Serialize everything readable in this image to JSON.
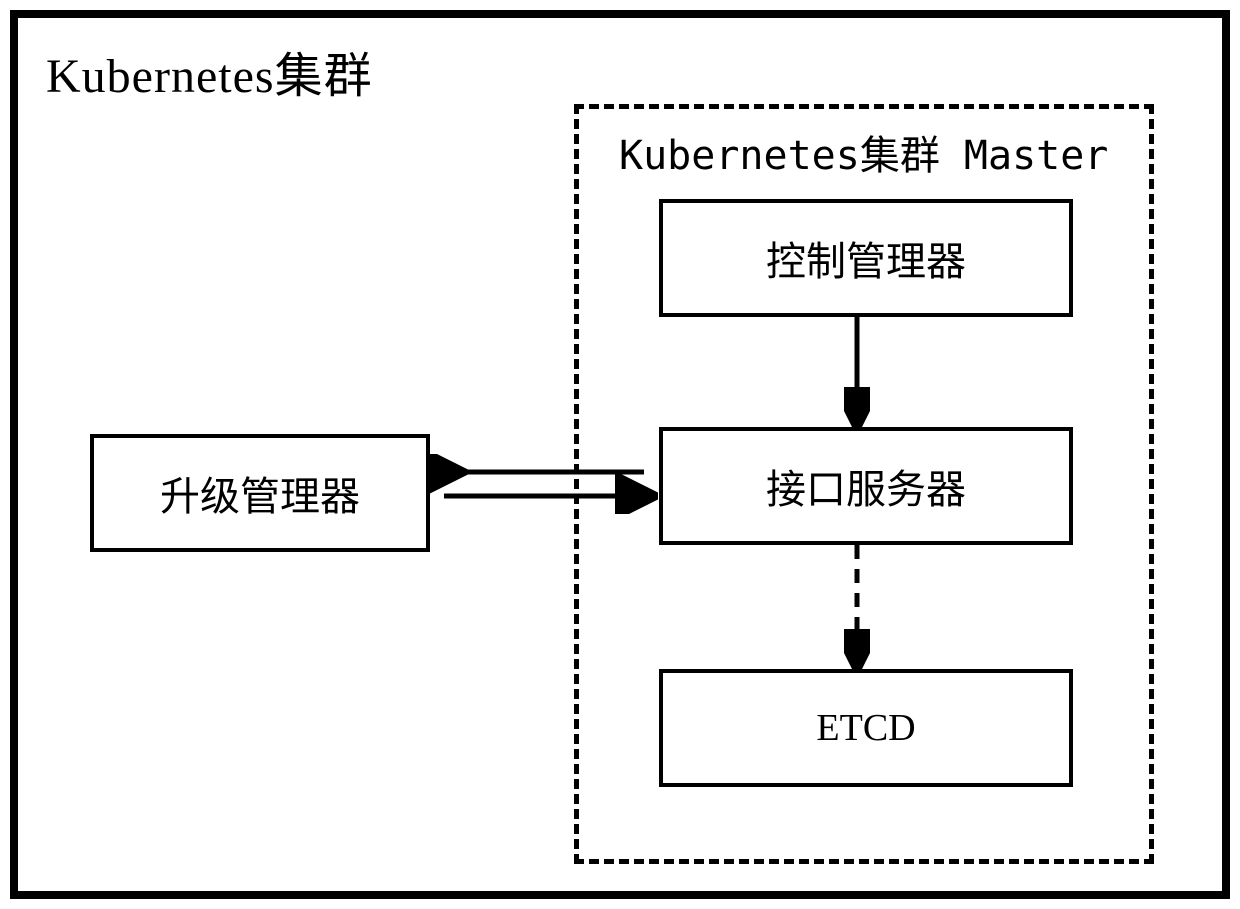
{
  "cluster": {
    "title": "Kubernetes集群"
  },
  "master": {
    "title": "Kubernetes集群 Master",
    "controller": "控制管理器",
    "interface": "接口服务器",
    "etcd": "ETCD"
  },
  "external": {
    "upgrade_manager": "升级管理器"
  }
}
